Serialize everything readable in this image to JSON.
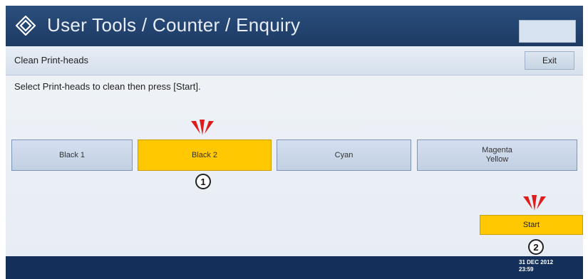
{
  "header": {
    "title": "User Tools / Counter / Enquiry",
    "right_button_label": ""
  },
  "subheader": {
    "title": "Clean Print-heads",
    "exit_label": "Exit"
  },
  "main": {
    "instruction": "Select Print-heads to clean then press [Start].",
    "print_heads": [
      {
        "label": "Black 1",
        "selected": false
      },
      {
        "label": "Black 2",
        "selected": true
      },
      {
        "label": "Cyan",
        "selected": false
      },
      {
        "label": "Magenta\nYellow",
        "selected": false
      }
    ],
    "start_label": "Start",
    "step_markers": [
      "1",
      "2"
    ]
  },
  "footer": {
    "date": "31 DEC 2012",
    "time": "23:59"
  },
  "colors": {
    "title_bar": "#1d3a63",
    "selected": "#ffc800",
    "pointer": "#e01b1b",
    "footer": "#14305a"
  },
  "icons": {
    "logo": "diamond-logo-icon",
    "pointer": "pointer-burst-icon"
  }
}
